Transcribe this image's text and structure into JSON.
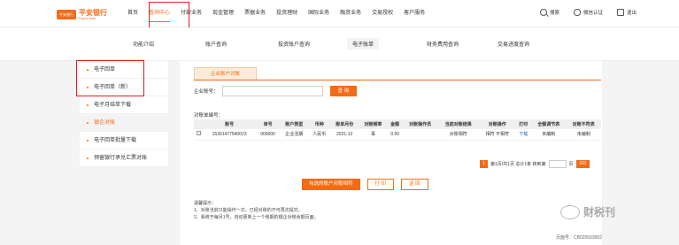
{
  "brand": {
    "mark": "平安银行",
    "name": "平安银行",
    "sub": "Ping An Bank"
  },
  "nav": {
    "items": [
      "首页",
      "查询中心",
      "付款业务",
      "现金管理",
      "票据业务",
      "投资理财",
      "国际业务",
      "融资业务",
      "交易授权",
      "客户服务"
    ],
    "active": "查询中心"
  },
  "tools": {
    "search": "搜索",
    "wechat": "微信认证",
    "logout": "退出"
  },
  "subnav": {
    "items": [
      "功能介绍",
      "账户查询",
      "投资账户查询",
      "电子账单",
      "财务费用查询",
      "交易进度查询"
    ],
    "active": "电子账单"
  },
  "sidebar": {
    "items": [
      "电子回单",
      "电子回单（新）",
      "电子月结单下载",
      "银企对账",
      "电子回单批量下载",
      "预留银行承兑汇票对账"
    ],
    "active": "银企对账"
  },
  "main": {
    "tab": "企业账户对账",
    "account_label": "企业账号：",
    "account_value": "",
    "query_btn": "查 询",
    "statement_label": "对账单编号：",
    "columns": [
      "",
      "账号",
      "单号",
      "账户类型",
      "币种",
      "账单月份",
      "对账频率",
      "金额",
      "对账操作员",
      "当前对账结果",
      "对账操作",
      "打印",
      "全额调节表",
      "对账不符表"
    ],
    "rows": [
      {
        "account": "15301477540023",
        "no": "000000",
        "type": "企业活期",
        "currency": "人民币",
        "month": "2021-12",
        "freq": "事",
        "amount": "0.00",
        "operator": "",
        "result": "对账相符",
        "op": "相符 不相符",
        "print": "下载",
        "adjust": "未编制",
        "mismatch": "未编制"
      }
    ],
    "pager": {
      "current": "1",
      "info": "第1页/共1页 总计1条 转到第",
      "unit": "页",
      "go": "GO"
    },
    "actions": {
      "submit": "勾选的账户对账相符",
      "print": "打 印",
      "back": "返 回"
    },
    "notes": {
      "title": "温馨提示：",
      "items": [
        "1、对账当前只能操作一次，已经对账的不可再次提交。",
        "2、系统于每月1号，自动更新上一个账期的银企对账余额页面。"
      ]
    },
    "page_no": "页面号：CB020503002"
  },
  "watermark": "财税刊",
  "colors": {
    "accent": "#f26c17",
    "highlight": "#e0201b"
  }
}
